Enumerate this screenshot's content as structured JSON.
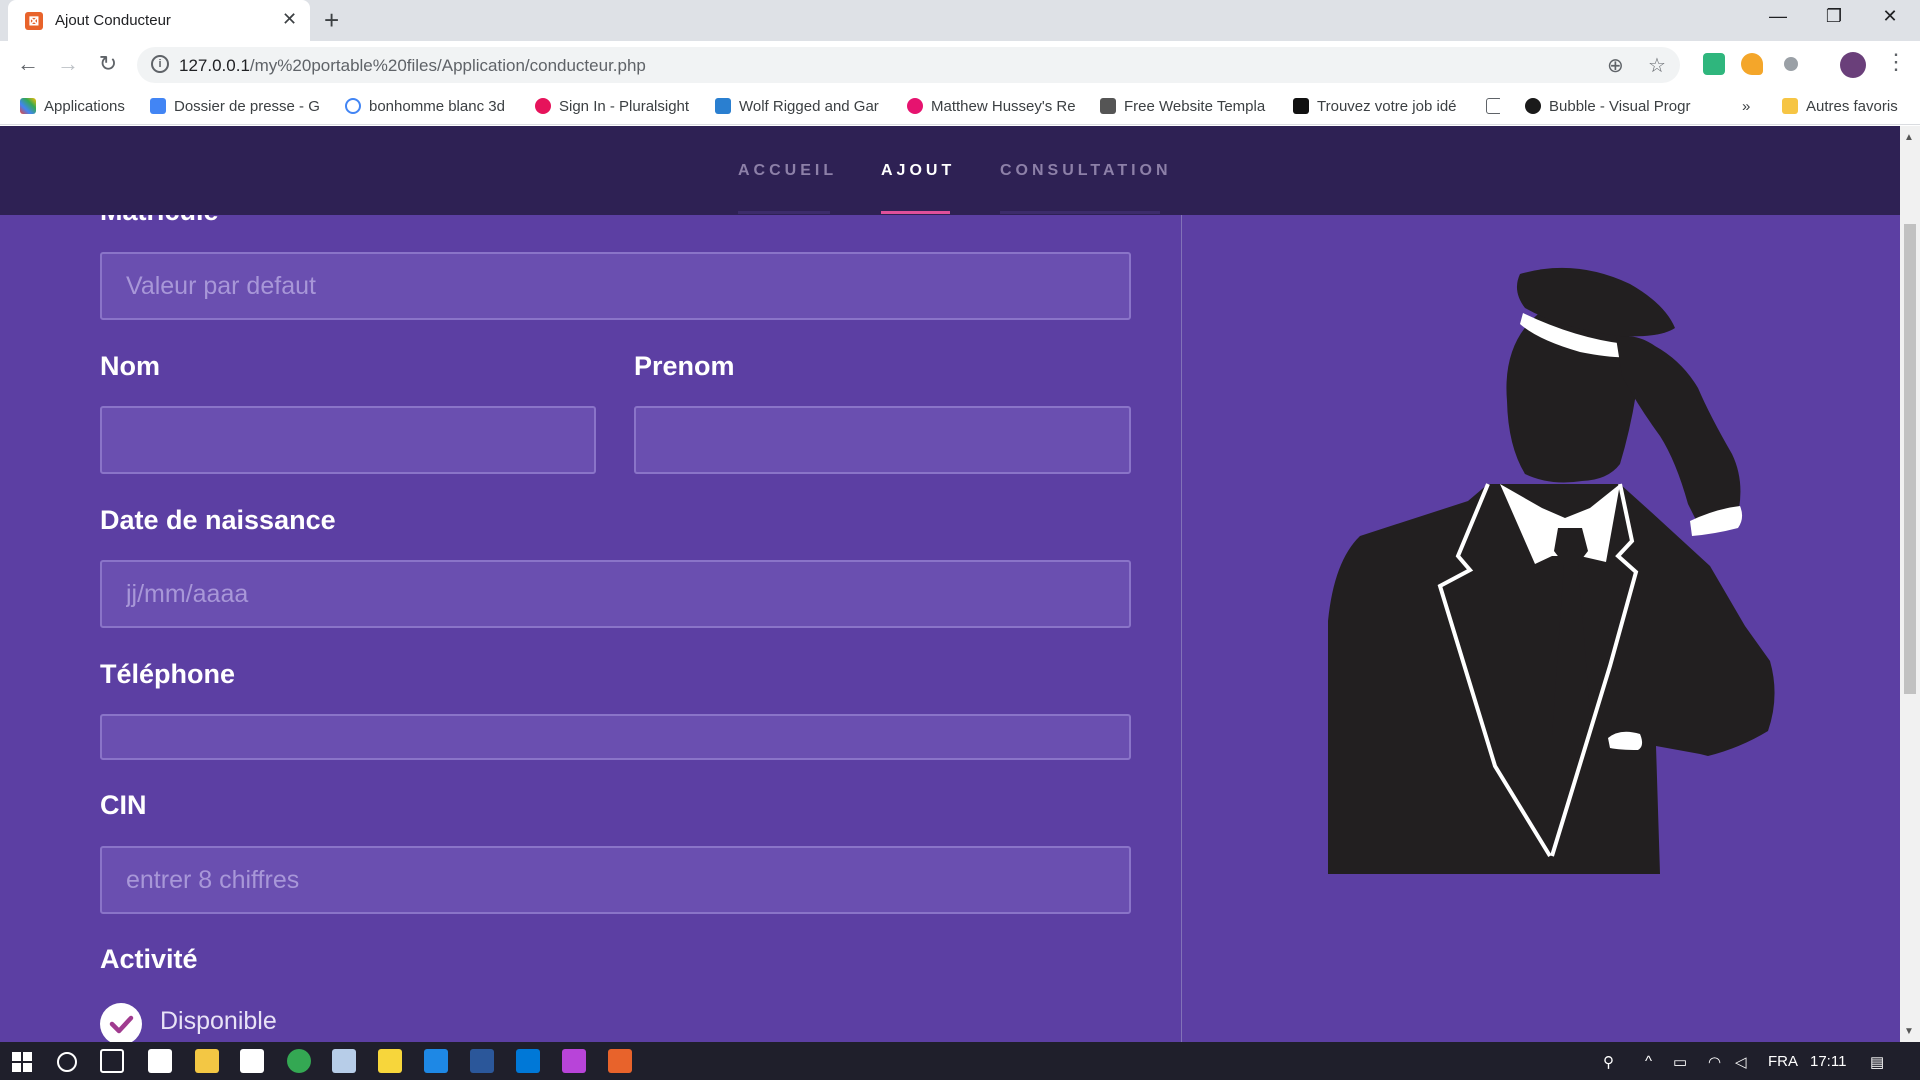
{
  "browser": {
    "tab_title": "Ajout Conducteur",
    "url_host": "127.0.0.1",
    "url_path": "/my%20portable%20files/Application/conducteur.php",
    "bookmarks": [
      "Applications",
      "Dossier de presse - G",
      "bonhomme blanc 3d",
      "Sign In - Pluralsight",
      "Wolf Rigged and Gar",
      "Matthew Hussey's Re",
      "Free Website Templa",
      "Trouvez votre job idé",
      "Bubble - Visual Progr",
      "Autres favoris"
    ],
    "bookmarks_more": "»"
  },
  "nav": {
    "links": [
      "ACCUEIL",
      "AJOUT",
      "CONSULTATION"
    ],
    "active": "AJOUT"
  },
  "form": {
    "matricule_label": "Matricule",
    "matricule_placeholder": "Valeur par defaut",
    "nom_label": "Nom",
    "prenom_label": "Prenom",
    "date_label": "Date de naissance",
    "date_placeholder": "jj/mm/aaaa",
    "telephone_label": "Téléphone",
    "cin_label": "CIN",
    "cin_placeholder": "entrer 8 chiffres",
    "activite_label": "Activité",
    "disponible_label": "Disponible"
  },
  "taskbar": {
    "language": "FRA",
    "time": "17:11"
  },
  "colors": {
    "page_bg": "#5c3fa3",
    "nav_bg": "#2e2154",
    "accent": "#e0509a"
  }
}
